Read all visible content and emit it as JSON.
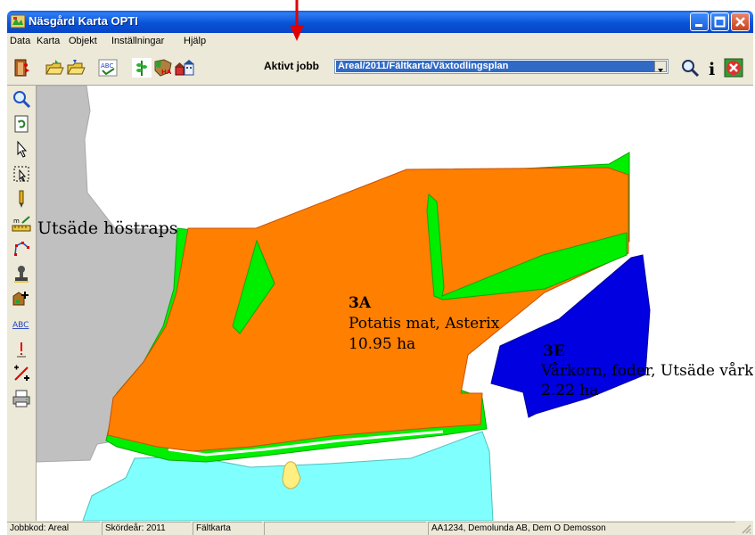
{
  "window": {
    "title": "Näsgård Karta OPTI"
  },
  "menu": [
    "Data",
    "Karta",
    "Objekt",
    "Inställningar",
    "Hjälp"
  ],
  "toolbar": {
    "active_job_label": "Aktivt jobb",
    "active_job_value": "Areal/2011/Fältkarta/Växtodlingsplan"
  },
  "map": {
    "label_west": "Utsäde höstraps",
    "field_3a": {
      "id": "3A",
      "crop": "Potatis mat, Asterix",
      "area": "10.95 ha"
    },
    "field_3e": {
      "id": "3E",
      "crop": "Vårkorn, foder, Utsäde vårkorn",
      "area": "2.22 ha"
    }
  },
  "status": {
    "jobbkod": "Jobbkod: Areal",
    "skordear": "Skördeår: 2011",
    "layer": "Fältkarta",
    "owner": "AA1234, Demolunda AB, Dem O Demosson"
  },
  "colors": {
    "orange": "#ff7f00",
    "green": "#00ee00",
    "blue": "#0000e0",
    "gray": "#c0c0c0",
    "cyan": "#80ffff",
    "yellow": "#ffee80",
    "arrow": "#e00000"
  }
}
